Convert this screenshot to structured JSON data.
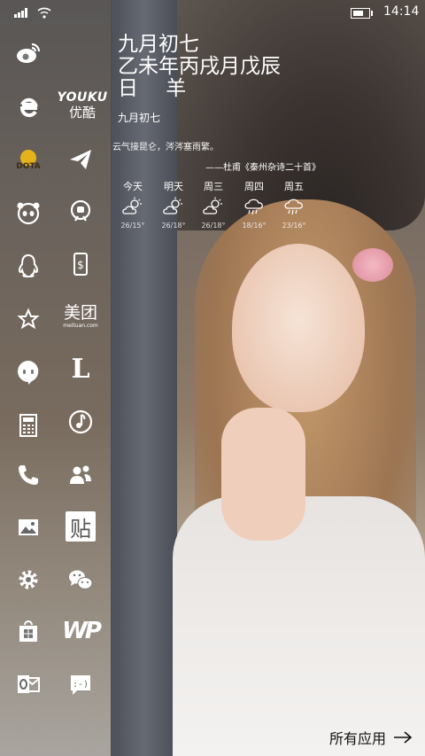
{
  "status": {
    "time": "14:14"
  },
  "lunar": {
    "line1": "九月初七",
    "line2": "乙未年丙戌月戊辰",
    "line3": "日 羊",
    "small": "九月初七"
  },
  "poem": {
    "text": "云气接昆仑，涔涔塞雨繁。",
    "author": "——杜甫《秦州杂诗二十首》"
  },
  "weather": [
    {
      "day": "今天",
      "icon": "sun-cloud-icon",
      "temp": "26/15°"
    },
    {
      "day": "明天",
      "icon": "sun-cloud-icon",
      "temp": "26/18°"
    },
    {
      "day": "周三",
      "icon": "sun-cloud-icon",
      "temp": "26/18°"
    },
    {
      "day": "周四",
      "icon": "rain-cloud-icon",
      "temp": "18/16°"
    },
    {
      "day": "周五",
      "icon": "rain-cloud-icon",
      "temp": "23/16°"
    }
  ],
  "tiles": {
    "youku_en": "YOUKU",
    "youku_cn": "优酷",
    "meituan_cn": "美团",
    "meituan_en": "meituan.com",
    "tieba": "贴",
    "l_app": "L",
    "wp": "WP"
  },
  "footer": {
    "all_apps": "所有应用"
  }
}
